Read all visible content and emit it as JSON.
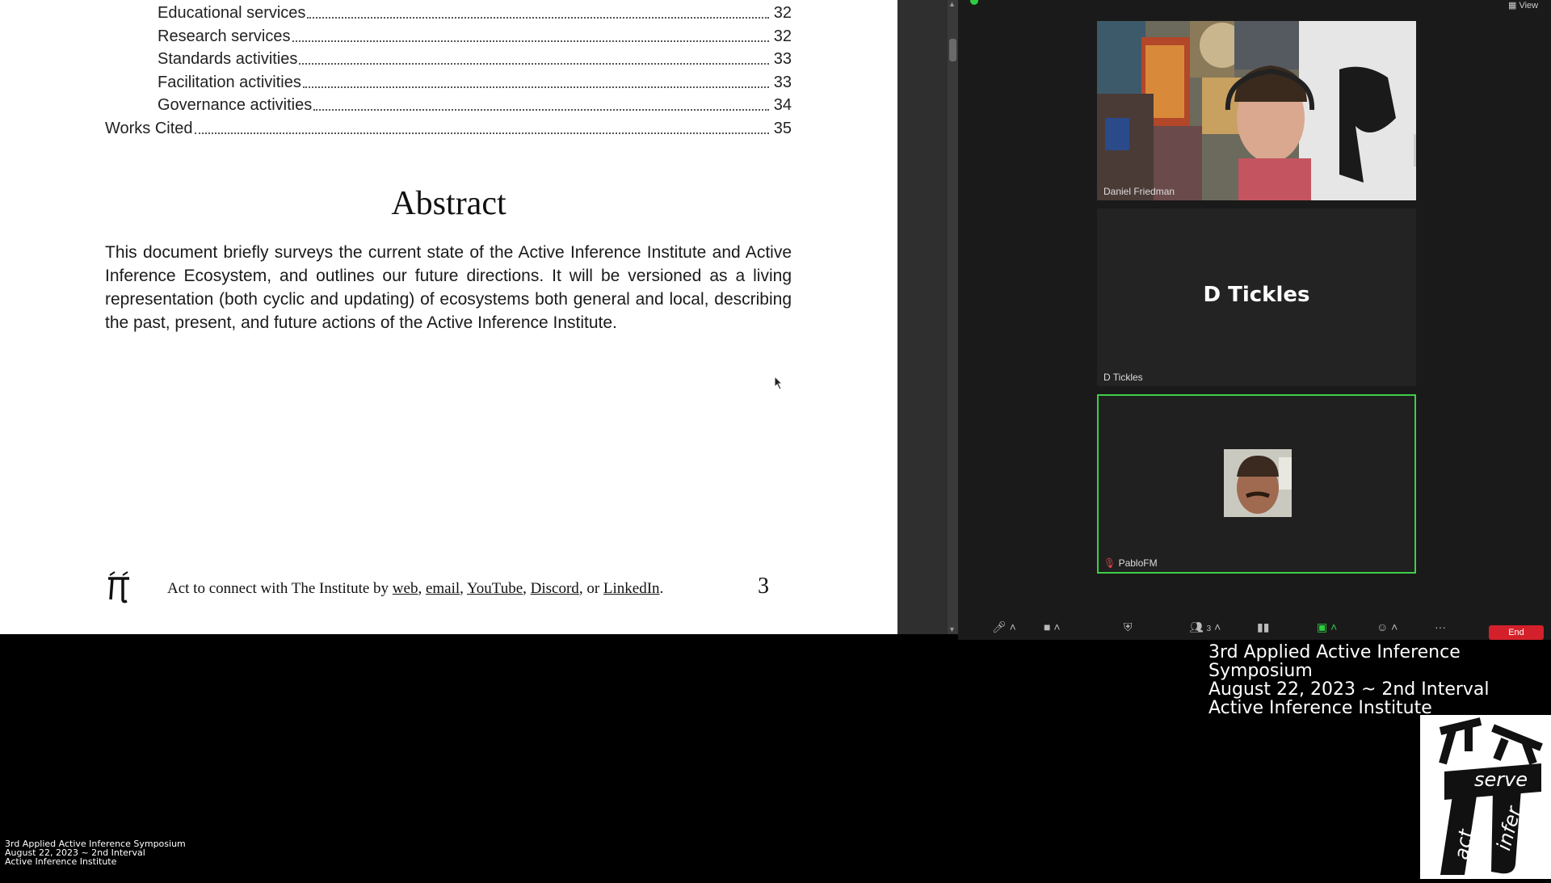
{
  "toc": [
    {
      "label": "Educational services",
      "page": "32",
      "indent": true
    },
    {
      "label": "Research services",
      "page": "32",
      "indent": true
    },
    {
      "label": "Standards activities",
      "page": "33",
      "indent": true
    },
    {
      "label": "Facilitation activities",
      "page": "33",
      "indent": true
    },
    {
      "label": "Governance activities",
      "page": "34",
      "indent": true
    },
    {
      "label": "Works Cited",
      "page": "35",
      "indent": false
    }
  ],
  "abstract": {
    "title": "Abstract",
    "body": "This document briefly surveys the current state of the Active Inference Institute and Active Inference Ecosystem, and outlines our future directions. It will be versioned as a living representation (both cyclic and updating) of ecosystems both general and local, describing the past, present, and future actions of the Active Inference Institute."
  },
  "footer": {
    "prefix": "Act to connect with The Institute by ",
    "links": [
      "web",
      "email",
      "YouTube",
      "Discord",
      "LinkedIn"
    ],
    "sep1": ", ",
    "sep_or": ", or ",
    "suffix": ".",
    "page_number": "3"
  },
  "zoom": {
    "view_label": "View",
    "participants": [
      {
        "name": "Daniel Friedman",
        "type": "video"
      },
      {
        "name": "D Tickles",
        "display_big": "D Tickles",
        "type": "name-only"
      },
      {
        "name": "PabloFM",
        "type": "avatar",
        "active_speaker": true
      }
    ],
    "participant_count": "3",
    "end_label": "End",
    "accent_green": "#3fce4a",
    "end_red": "#d3202a"
  },
  "overlay": {
    "line1": "3rd Applied Active Inference Symposium",
    "line2": "August 22, 2023 ~ 2nd Interval",
    "line3": "Active Inference Institute"
  },
  "logo": {
    "serve": "serve",
    "act": "act",
    "infer": "infer"
  }
}
